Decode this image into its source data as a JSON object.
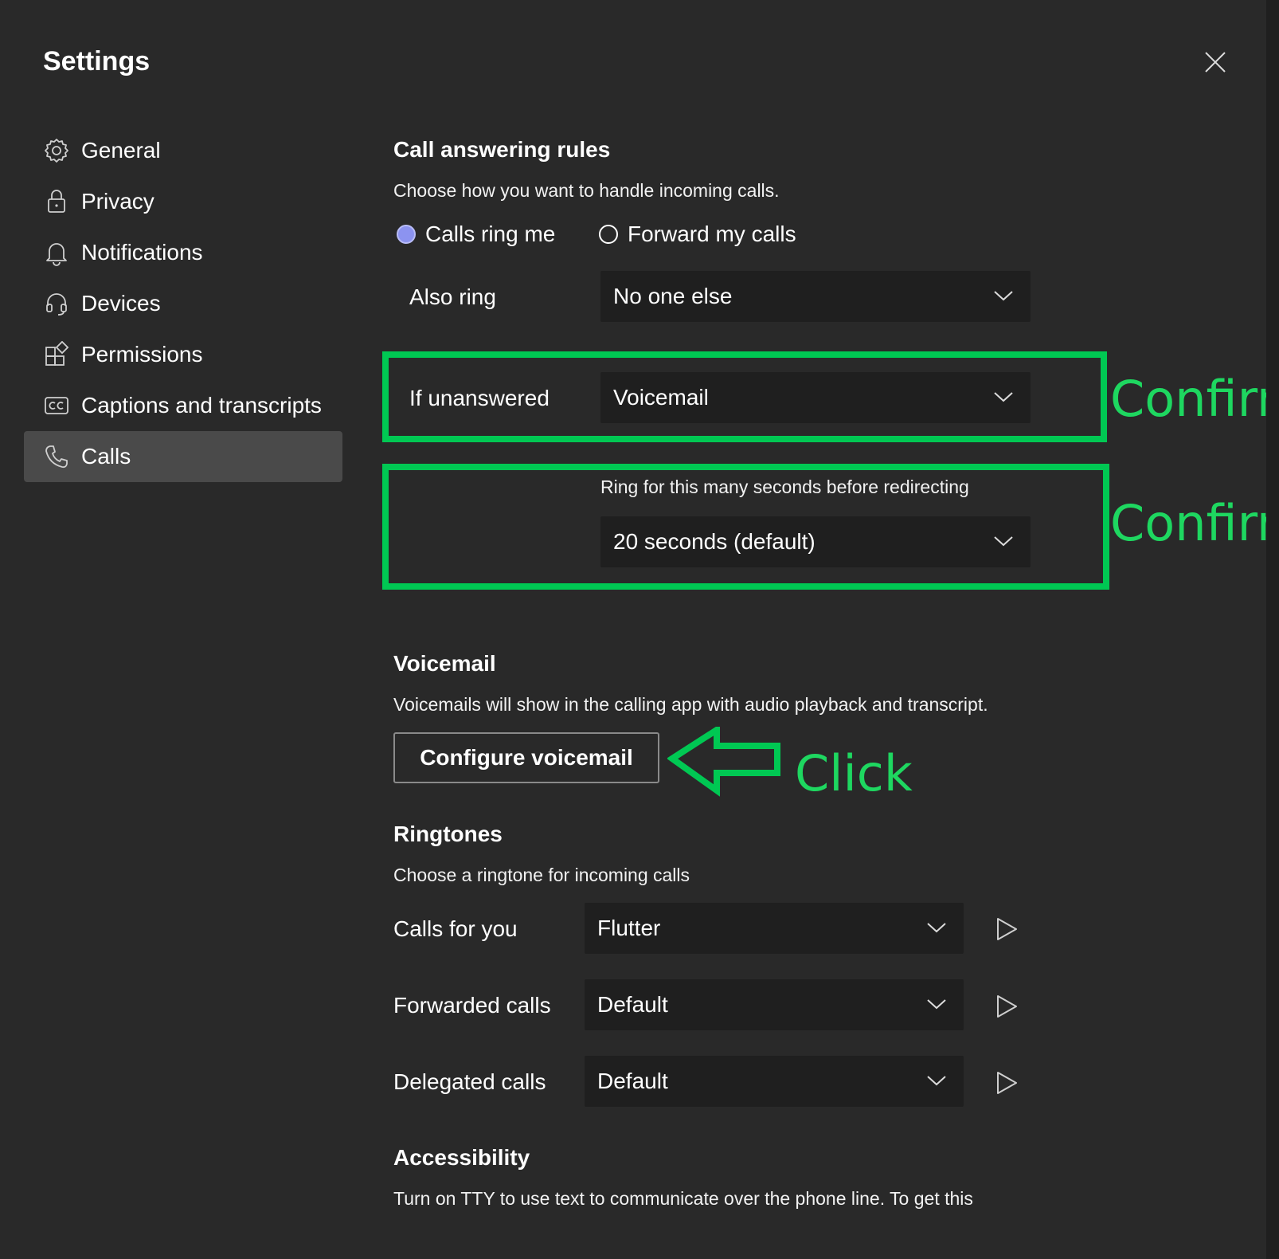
{
  "dialog": {
    "title": "Settings",
    "close_icon": "close-icon"
  },
  "nav": {
    "items": [
      {
        "label": "General",
        "icon": "gear-icon"
      },
      {
        "label": "Privacy",
        "icon": "lock-icon"
      },
      {
        "label": "Notifications",
        "icon": "bell-icon"
      },
      {
        "label": "Devices",
        "icon": "headset-icon"
      },
      {
        "label": "Permissions",
        "icon": "apps-icon"
      },
      {
        "label": "Captions and transcripts",
        "icon": "cc-icon"
      },
      {
        "label": "Calls",
        "icon": "phone-icon",
        "active": true
      }
    ]
  },
  "call_rules": {
    "heading": "Call answering rules",
    "description": "Choose how you want to handle incoming calls.",
    "radio_ring_me": "Calls ring me",
    "radio_forward": "Forward my calls",
    "also_ring_label": "Also ring",
    "also_ring_value": "No one else",
    "unanswered_label": "If unanswered",
    "unanswered_value": "Voicemail",
    "ring_seconds_label": "Ring for this many seconds before redirecting",
    "ring_seconds_value": "20 seconds (default)"
  },
  "voicemail": {
    "heading": "Voicemail",
    "description": "Voicemails will show in the calling app with audio playback and transcript.",
    "configure_button": "Configure voicemail"
  },
  "ringtones": {
    "heading": "Ringtones",
    "description": "Choose a ringtone for incoming calls",
    "rows": [
      {
        "label": "Calls for you",
        "value": "Flutter"
      },
      {
        "label": "Forwarded calls",
        "value": "Default"
      },
      {
        "label": "Delegated calls",
        "value": "Default"
      }
    ]
  },
  "accessibility": {
    "heading": "Accessibility",
    "description": "Turn on TTY to use text to communicate over the phone line. To get this"
  },
  "annotations": {
    "confirm_1": "Confirm",
    "confirm_2": "Confirm",
    "click": "Click",
    "color": "#00c853"
  },
  "colors": {
    "background": "#292929",
    "select_bg": "#1f1f1f",
    "radio_accent": "#8c93f0"
  }
}
